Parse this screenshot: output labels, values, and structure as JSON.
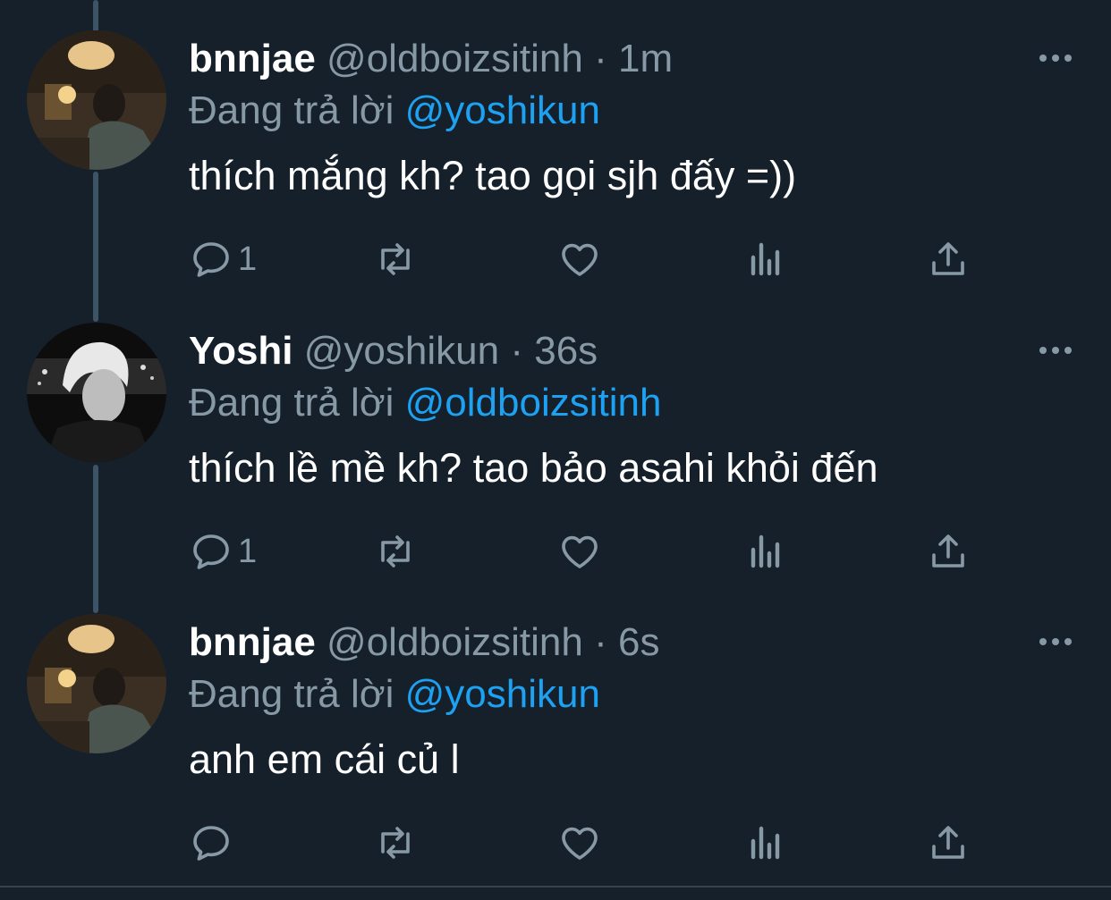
{
  "colors": {
    "background": "#15202b",
    "secondary_text": "#8899a6",
    "mention": "#1da1f2",
    "thread_line": "#3d5466"
  },
  "tweets": [
    {
      "name": "bnnjae",
      "handle": "@oldboizsitinh",
      "sep": "·",
      "time": "1m",
      "reply_prefix": "Đang trả lời",
      "reply_to": "@yoshikun",
      "text": "thích mắng kh? tao gọi sjh đấy =))",
      "reply_count": "1",
      "avatar": "avatar-bnnjae"
    },
    {
      "name": "Yoshi",
      "handle": "@yoshikun",
      "sep": "·",
      "time": "36s",
      "reply_prefix": "Đang trả lời",
      "reply_to": "@oldboizsitinh",
      "text": "thích lề mề kh? tao bảo asahi khỏi đến",
      "reply_count": "1",
      "avatar": "avatar-yoshi"
    },
    {
      "name": "bnnjae",
      "handle": "@oldboizsitinh",
      "sep": "·",
      "time": "6s",
      "reply_prefix": "Đang trả lời",
      "reply_to": "@yoshikun",
      "text": "anh em cái củ l",
      "reply_count": "",
      "avatar": "avatar-bnnjae"
    }
  ],
  "icons": [
    "reply-icon",
    "retweet-icon",
    "like-icon",
    "analytics-icon",
    "share-icon",
    "more-icon"
  ]
}
